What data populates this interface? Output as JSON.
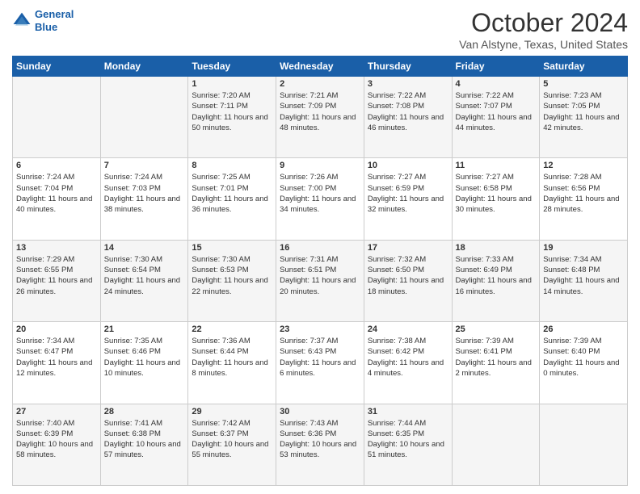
{
  "header": {
    "logo_line1": "General",
    "logo_line2": "Blue",
    "title": "October 2024",
    "location": "Van Alstyne, Texas, United States"
  },
  "days_of_week": [
    "Sunday",
    "Monday",
    "Tuesday",
    "Wednesday",
    "Thursday",
    "Friday",
    "Saturday"
  ],
  "weeks": [
    [
      {
        "day": "",
        "info": ""
      },
      {
        "day": "",
        "info": ""
      },
      {
        "day": "1",
        "info": "Sunrise: 7:20 AM\nSunset: 7:11 PM\nDaylight: 11 hours and 50 minutes."
      },
      {
        "day": "2",
        "info": "Sunrise: 7:21 AM\nSunset: 7:09 PM\nDaylight: 11 hours and 48 minutes."
      },
      {
        "day": "3",
        "info": "Sunrise: 7:22 AM\nSunset: 7:08 PM\nDaylight: 11 hours and 46 minutes."
      },
      {
        "day": "4",
        "info": "Sunrise: 7:22 AM\nSunset: 7:07 PM\nDaylight: 11 hours and 44 minutes."
      },
      {
        "day": "5",
        "info": "Sunrise: 7:23 AM\nSunset: 7:05 PM\nDaylight: 11 hours and 42 minutes."
      }
    ],
    [
      {
        "day": "6",
        "info": "Sunrise: 7:24 AM\nSunset: 7:04 PM\nDaylight: 11 hours and 40 minutes."
      },
      {
        "day": "7",
        "info": "Sunrise: 7:24 AM\nSunset: 7:03 PM\nDaylight: 11 hours and 38 minutes."
      },
      {
        "day": "8",
        "info": "Sunrise: 7:25 AM\nSunset: 7:01 PM\nDaylight: 11 hours and 36 minutes."
      },
      {
        "day": "9",
        "info": "Sunrise: 7:26 AM\nSunset: 7:00 PM\nDaylight: 11 hours and 34 minutes."
      },
      {
        "day": "10",
        "info": "Sunrise: 7:27 AM\nSunset: 6:59 PM\nDaylight: 11 hours and 32 minutes."
      },
      {
        "day": "11",
        "info": "Sunrise: 7:27 AM\nSunset: 6:58 PM\nDaylight: 11 hours and 30 minutes."
      },
      {
        "day": "12",
        "info": "Sunrise: 7:28 AM\nSunset: 6:56 PM\nDaylight: 11 hours and 28 minutes."
      }
    ],
    [
      {
        "day": "13",
        "info": "Sunrise: 7:29 AM\nSunset: 6:55 PM\nDaylight: 11 hours and 26 minutes."
      },
      {
        "day": "14",
        "info": "Sunrise: 7:30 AM\nSunset: 6:54 PM\nDaylight: 11 hours and 24 minutes."
      },
      {
        "day": "15",
        "info": "Sunrise: 7:30 AM\nSunset: 6:53 PM\nDaylight: 11 hours and 22 minutes."
      },
      {
        "day": "16",
        "info": "Sunrise: 7:31 AM\nSunset: 6:51 PM\nDaylight: 11 hours and 20 minutes."
      },
      {
        "day": "17",
        "info": "Sunrise: 7:32 AM\nSunset: 6:50 PM\nDaylight: 11 hours and 18 minutes."
      },
      {
        "day": "18",
        "info": "Sunrise: 7:33 AM\nSunset: 6:49 PM\nDaylight: 11 hours and 16 minutes."
      },
      {
        "day": "19",
        "info": "Sunrise: 7:34 AM\nSunset: 6:48 PM\nDaylight: 11 hours and 14 minutes."
      }
    ],
    [
      {
        "day": "20",
        "info": "Sunrise: 7:34 AM\nSunset: 6:47 PM\nDaylight: 11 hours and 12 minutes."
      },
      {
        "day": "21",
        "info": "Sunrise: 7:35 AM\nSunset: 6:46 PM\nDaylight: 11 hours and 10 minutes."
      },
      {
        "day": "22",
        "info": "Sunrise: 7:36 AM\nSunset: 6:44 PM\nDaylight: 11 hours and 8 minutes."
      },
      {
        "day": "23",
        "info": "Sunrise: 7:37 AM\nSunset: 6:43 PM\nDaylight: 11 hours and 6 minutes."
      },
      {
        "day": "24",
        "info": "Sunrise: 7:38 AM\nSunset: 6:42 PM\nDaylight: 11 hours and 4 minutes."
      },
      {
        "day": "25",
        "info": "Sunrise: 7:39 AM\nSunset: 6:41 PM\nDaylight: 11 hours and 2 minutes."
      },
      {
        "day": "26",
        "info": "Sunrise: 7:39 AM\nSunset: 6:40 PM\nDaylight: 11 hours and 0 minutes."
      }
    ],
    [
      {
        "day": "27",
        "info": "Sunrise: 7:40 AM\nSunset: 6:39 PM\nDaylight: 10 hours and 58 minutes."
      },
      {
        "day": "28",
        "info": "Sunrise: 7:41 AM\nSunset: 6:38 PM\nDaylight: 10 hours and 57 minutes."
      },
      {
        "day": "29",
        "info": "Sunrise: 7:42 AM\nSunset: 6:37 PM\nDaylight: 10 hours and 55 minutes."
      },
      {
        "day": "30",
        "info": "Sunrise: 7:43 AM\nSunset: 6:36 PM\nDaylight: 10 hours and 53 minutes."
      },
      {
        "day": "31",
        "info": "Sunrise: 7:44 AM\nSunset: 6:35 PM\nDaylight: 10 hours and 51 minutes."
      },
      {
        "day": "",
        "info": ""
      },
      {
        "day": "",
        "info": ""
      }
    ]
  ]
}
